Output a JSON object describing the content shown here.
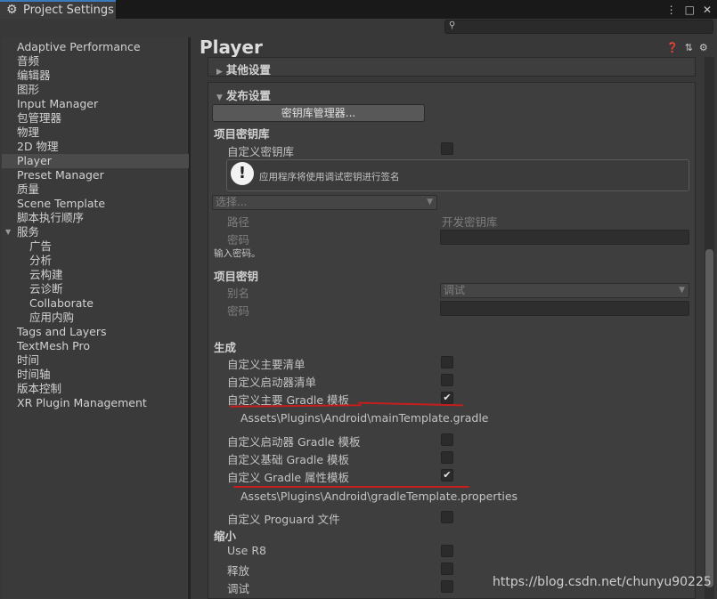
{
  "window": {
    "tab_title": "Project Settings",
    "tab_icon": "gear-icon",
    "controls": [
      "⋮",
      "□",
      "✕"
    ]
  },
  "search": {
    "placeholder": ""
  },
  "sidebar": {
    "items": [
      {
        "label": "Adaptive Performance",
        "indent": 0
      },
      {
        "label": "音频",
        "indent": 0
      },
      {
        "label": "编辑器",
        "indent": 0
      },
      {
        "label": "图形",
        "indent": 0
      },
      {
        "label": "Input Manager",
        "indent": 0
      },
      {
        "label": "包管理器",
        "indent": 0
      },
      {
        "label": "物理",
        "indent": 0
      },
      {
        "label": "2D 物理",
        "indent": 0
      },
      {
        "label": "Player",
        "indent": 0,
        "selected": true
      },
      {
        "label": "Preset Manager",
        "indent": 0
      },
      {
        "label": "质量",
        "indent": 0
      },
      {
        "label": "Scene Template",
        "indent": 0
      },
      {
        "label": "脚本执行顺序",
        "indent": 0
      },
      {
        "label": "服务",
        "indent": 0,
        "expanded": true
      },
      {
        "label": "广告",
        "indent": 1
      },
      {
        "label": "分析",
        "indent": 1
      },
      {
        "label": "云构建",
        "indent": 1
      },
      {
        "label": "云诊断",
        "indent": 1
      },
      {
        "label": "Collaborate",
        "indent": 1
      },
      {
        "label": "应用内购",
        "indent": 1
      },
      {
        "label": "Tags and Layers",
        "indent": 0
      },
      {
        "label": "TextMesh Pro",
        "indent": 0
      },
      {
        "label": "时间",
        "indent": 0
      },
      {
        "label": "时间轴",
        "indent": 0
      },
      {
        "label": "版本控制",
        "indent": 0
      },
      {
        "label": "XR Plugin Management",
        "indent": 0
      }
    ]
  },
  "main": {
    "title": "Player",
    "header_icons": [
      "help-icon",
      "sliders-icon",
      "gear-icon"
    ],
    "other_settings": "其他设置",
    "publishing": {
      "title": "发布设置",
      "keystore_manager_button": "密钥库管理器...",
      "project_keystore": "项目密钥库",
      "custom_keystore": "自定义密钥库",
      "custom_keystore_checked": false,
      "help_message": "应用程序将使用调试密钥进行签名",
      "select_placeholder": "选择...",
      "path_label": "路径",
      "path_value": "开发密钥库",
      "password_label": "密码",
      "enter_password": "输入密码。",
      "project_key": "项目密钥",
      "alias_label": "别名",
      "alias_value": "调试",
      "key_password_label": "密码"
    },
    "build": {
      "title": "生成",
      "options": [
        {
          "label": "自定义主要清单",
          "checked": false
        },
        {
          "label": "自定义启动器清单",
          "checked": false
        },
        {
          "label": "自定义主要 Gradle 模板",
          "checked": true,
          "path": "Assets\\Plugins\\Android\\mainTemplate.gradle"
        },
        {
          "label": "自定义启动器 Gradle 模板",
          "checked": false
        },
        {
          "label": "自定义基础 Gradle 模板",
          "checked": false
        },
        {
          "label": "自定义 Gradle 属性模板",
          "checked": true,
          "path": "Assets\\Plugins\\Android\\gradleTemplate.properties"
        },
        {
          "label": "自定义 Proguard 文件",
          "checked": false
        }
      ]
    },
    "minify": {
      "title": "缩小",
      "options": [
        {
          "label": "Use R8",
          "checked": false
        },
        {
          "label": "释放",
          "checked": false
        },
        {
          "label": "调试",
          "checked": false
        }
      ]
    }
  },
  "watermark": "https://blog.csdn.net/chunyu90225",
  "colors": {
    "annotation_red": "#c81d1d",
    "selection": "#4b4b4b",
    "tab_accent": "#3a79bb"
  }
}
